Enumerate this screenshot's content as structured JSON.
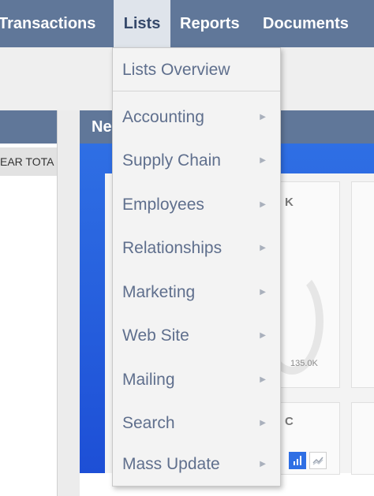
{
  "nav": {
    "items": [
      {
        "label": "Transactions",
        "active": false
      },
      {
        "label": "Lists",
        "active": true
      },
      {
        "label": "Reports",
        "active": false
      },
      {
        "label": "Documents",
        "active": false
      }
    ]
  },
  "background": {
    "left_panel_tab": "EAR TOTA",
    "right_panel_title": "Ne",
    "card_b_letter": "K",
    "card_d_letter": "C",
    "gauge_value_label": "135.0K"
  },
  "dropdown": {
    "overview": "Lists Overview",
    "items": [
      {
        "label": "Accounting",
        "arrow": "▶"
      },
      {
        "label": "Supply Chain",
        "arrow": "▶"
      },
      {
        "label": "Employees",
        "arrow": "▶"
      },
      {
        "label": "Relationships",
        "arrow": "▶"
      },
      {
        "label": "Marketing",
        "arrow": "▶"
      },
      {
        "label": "Web Site",
        "arrow": "▶"
      },
      {
        "label": "Mailing",
        "arrow": "▶"
      },
      {
        "label": "Search",
        "arrow": "▶"
      },
      {
        "label": "Mass Update",
        "arrow": "▶"
      }
    ]
  },
  "colors": {
    "nav_bg": "#607799",
    "nav_active_bg": "#dfe4eb",
    "menu_text": "#5f6f8d",
    "hero_blue": "#2f6fe4"
  }
}
